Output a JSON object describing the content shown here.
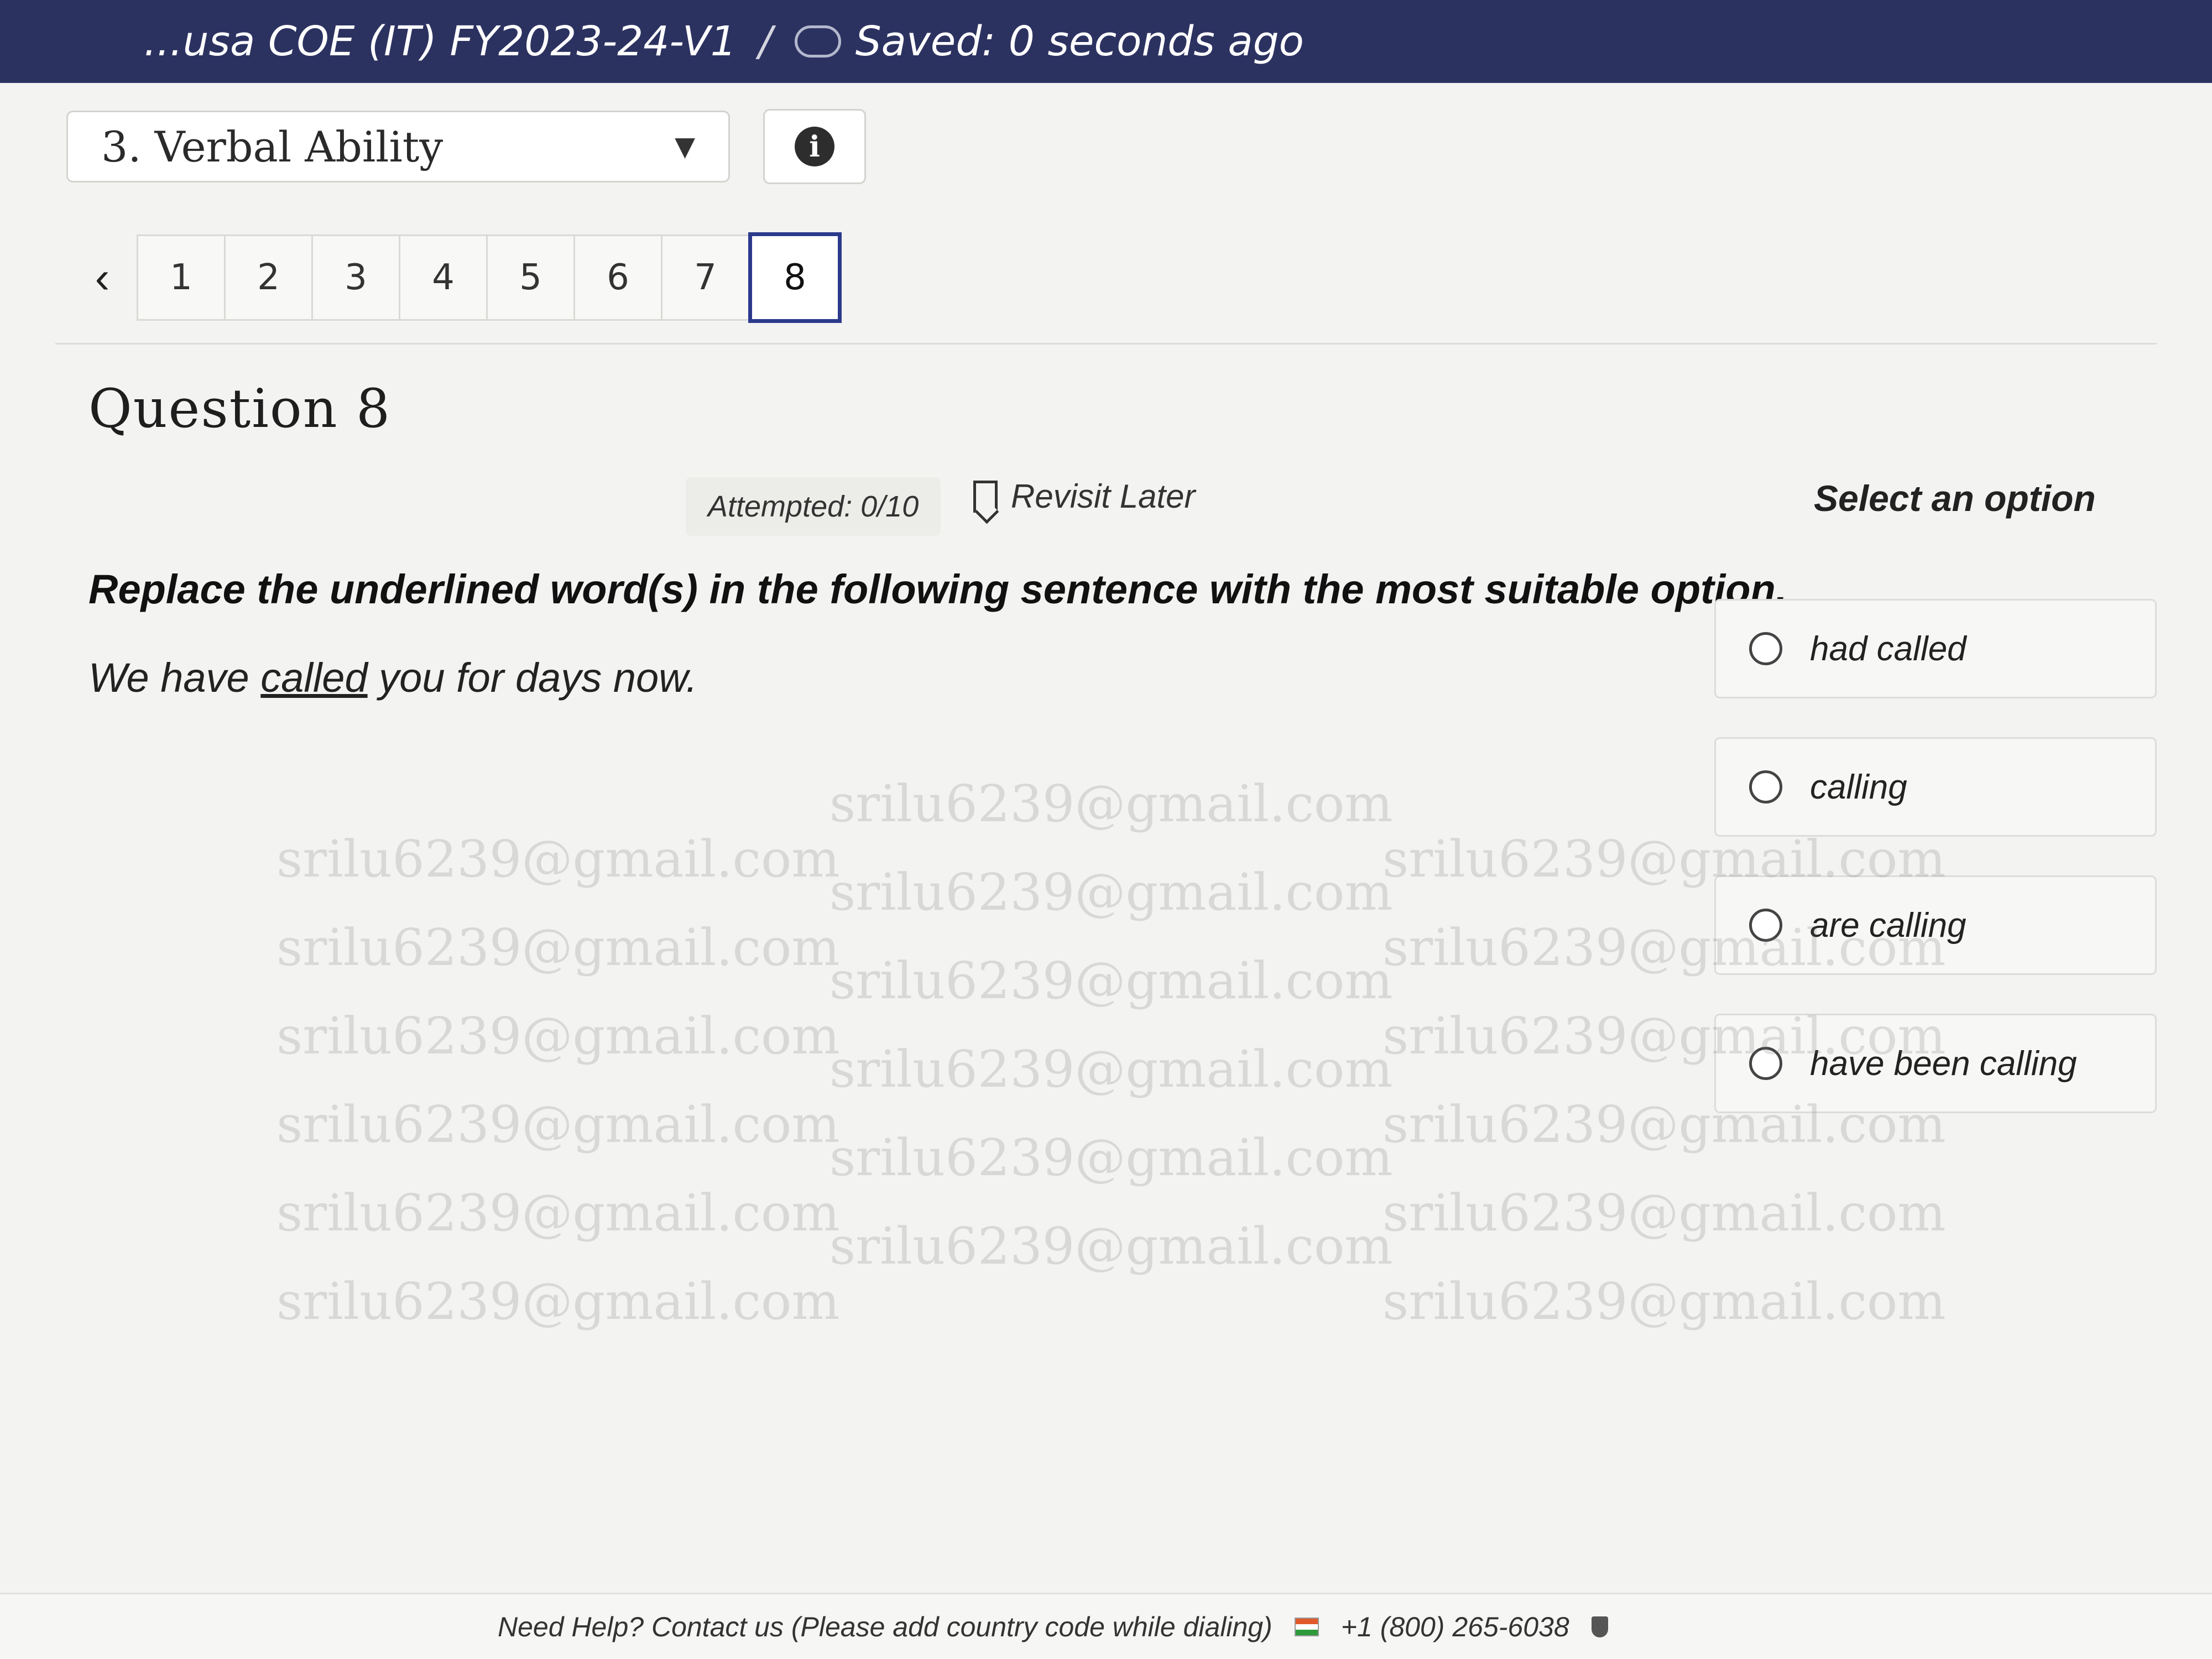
{
  "header": {
    "exam_title": "...usa COE (IT) FY2023-24-V1",
    "saved_status": "Saved: 0 seconds ago"
  },
  "section": {
    "selected": "3. Verbal Ability"
  },
  "question_nav": {
    "numbers": [
      "1",
      "2",
      "3",
      "4",
      "5",
      "6",
      "7",
      "8"
    ],
    "current": "8"
  },
  "question": {
    "title": "Question 8",
    "attempted": "Attempted: 0/10",
    "revisit_label": "Revisit Later",
    "select_label": "Select an option",
    "instruction": "Replace the underlined word(s) in the following sentence with the most suitable option.",
    "sentence_prefix": "We have ",
    "sentence_underlined": "called",
    "sentence_suffix": " you for days now.",
    "options": [
      "had called",
      "calling",
      "are calling",
      "have been calling"
    ]
  },
  "watermark": {
    "text": "srilu6239@gmail.com"
  },
  "footer": {
    "help_text": "Need Help? Contact us (Please add country code while dialing)",
    "phone_fragment": "+1 (800) 265-6038"
  }
}
